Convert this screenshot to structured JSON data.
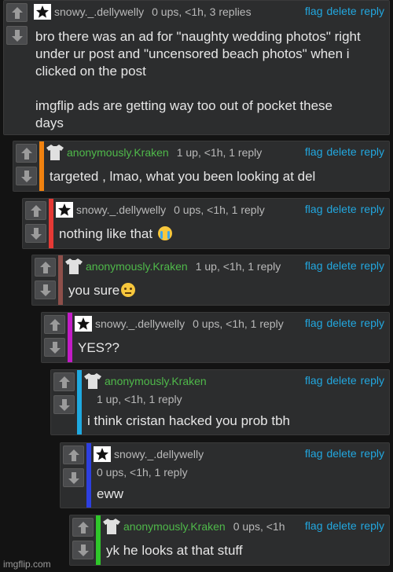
{
  "actions": {
    "flag": "flag",
    "delete": "delete",
    "reply": "reply"
  },
  "comments": [
    {
      "user": "snowy._.dellywelly",
      "meta": "0 ups, <1h, 3 replies",
      "text": "bro there was an ad for \"naughty wedding photos\" right\nunder ur post and \"uncensored beach photos\" when i\nclicked on the post\n\nimgflip ads are getting way too out of pocket these\ndays",
      "bar_color": ""
    },
    {
      "user": "anonymously.Kraken",
      "meta": "1 up, <1h, 1 reply",
      "text": "targeted , lmao, what you been looking at del",
      "bar_color": "#f0820f"
    },
    {
      "user": "snowy._.dellywelly",
      "meta": "0 ups, <1h, 1 reply",
      "text": "nothing like that",
      "bar_color": "#e53935"
    },
    {
      "user": "anonymously.Kraken",
      "meta": "1 up, <1h, 1 reply",
      "text": "you sure",
      "bar_color": "#8d4f4a"
    },
    {
      "user": "snowy._.dellywelly",
      "meta": "0 ups, <1h, 1 reply",
      "text": "YES??",
      "bar_color": "#c21cc6"
    },
    {
      "user": "anonymously.Kraken",
      "meta": "1 up, <1h, 1 reply",
      "text": "i think cristan hacked you prob tbh",
      "bar_color": "#1ea9e0"
    },
    {
      "user": "snowy._.dellywelly",
      "meta": "0 ups, <1h, 1 reply",
      "text": "eww",
      "bar_color": "#2d3fe0"
    },
    {
      "user": "anonymously.Kraken",
      "meta": "0 ups, <1h",
      "text": "yk he looks at that stuff",
      "bar_color": "#2fc72a"
    }
  ],
  "emoji": {
    "c2": "crying-face-emoji",
    "c3": "face-with-raised-eyebrow-emoji"
  },
  "footer": "imgflip.com",
  "colors": {
    "username_green": "#4fb94a",
    "action_blue": "#22a7df"
  }
}
